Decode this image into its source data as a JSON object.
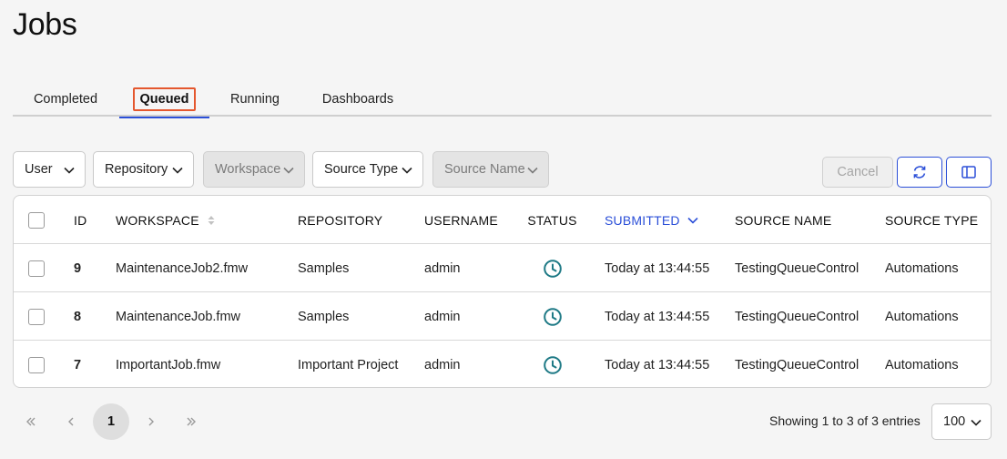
{
  "page": {
    "title": "Jobs"
  },
  "tabs": [
    {
      "label": "Completed"
    },
    {
      "label": "Queued",
      "active": true
    },
    {
      "label": "Running"
    },
    {
      "label": "Dashboards"
    }
  ],
  "filters": [
    {
      "label": "User",
      "disabled": false
    },
    {
      "label": "Repository",
      "disabled": false
    },
    {
      "label": "Workspace",
      "disabled": true
    },
    {
      "label": "Source Type",
      "disabled": false
    },
    {
      "label": "Source Name",
      "disabled": true
    }
  ],
  "actions": {
    "cancel_label": "Cancel",
    "refresh_icon": "refresh-icon",
    "columns_icon": "columns-icon"
  },
  "table": {
    "columns": {
      "id": "ID",
      "workspace": "WORKSPACE",
      "repository": "REPOSITORY",
      "username": "USERNAME",
      "status": "STATUS",
      "submitted": "SUBMITTED",
      "source_name": "SOURCE NAME",
      "source_type": "SOURCE TYPE"
    },
    "sorted_column": "submitted",
    "rows": [
      {
        "id": "9",
        "workspace": "MaintenanceJob2.fmw",
        "repository": "Samples",
        "username": "admin",
        "status": "queued",
        "submitted": "Today at 13:44:55",
        "source_name": "TestingQueueControl",
        "source_type": "Automations"
      },
      {
        "id": "8",
        "workspace": "MaintenanceJob.fmw",
        "repository": "Samples",
        "username": "admin",
        "status": "queued",
        "submitted": "Today at 13:44:55",
        "source_name": "TestingQueueControl",
        "source_type": "Automations"
      },
      {
        "id": "7",
        "workspace": "ImportantJob.fmw",
        "repository": "Important Project",
        "username": "admin",
        "status": "queued",
        "submitted": "Today at 13:44:55",
        "source_name": "TestingQueueControl",
        "source_type": "Automations"
      }
    ]
  },
  "pagination": {
    "current_page": "1",
    "showing_text": "Showing 1 to 3 of 3 entries",
    "page_size": "100"
  },
  "colors": {
    "accent": "#2b4fd8",
    "focus_ring": "#e4572e",
    "status_clock": "#1f7a86"
  }
}
